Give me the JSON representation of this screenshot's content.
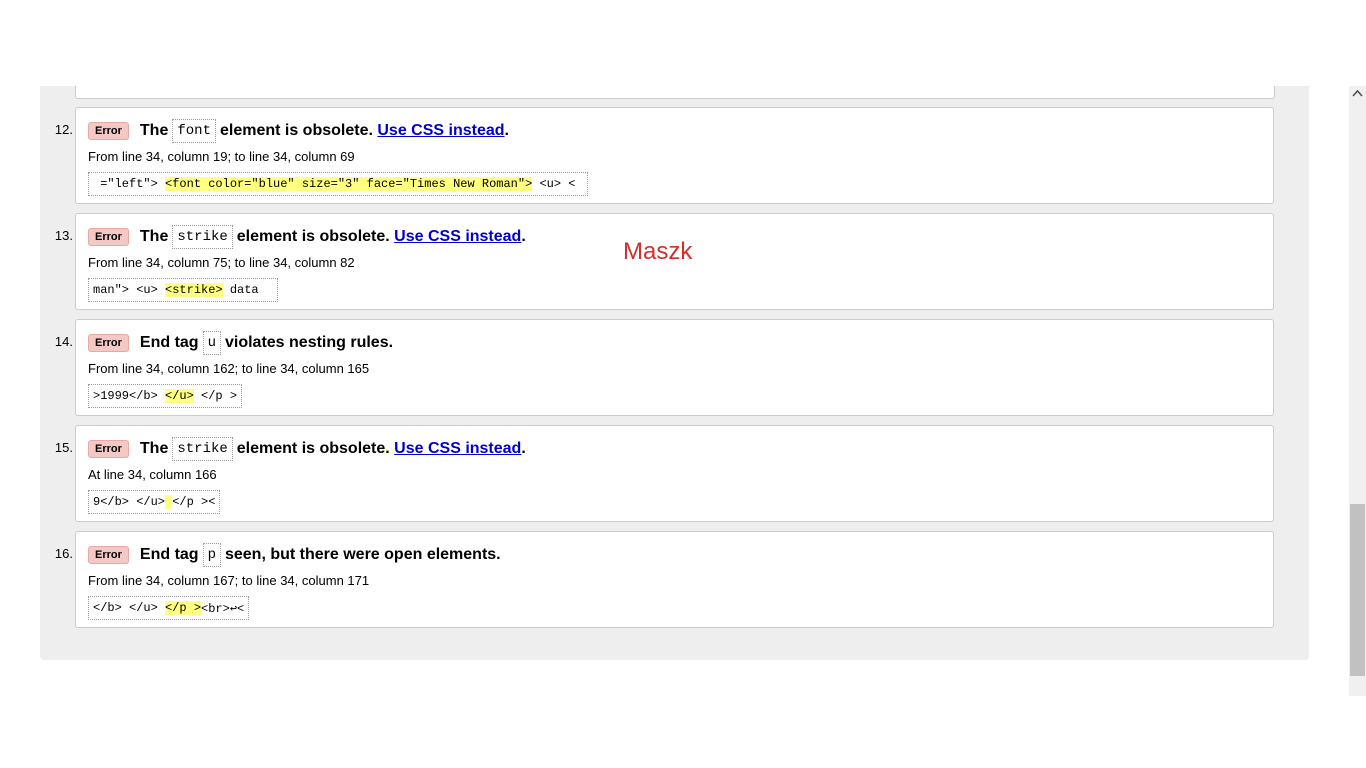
{
  "messages": [
    {
      "number": "12.",
      "type": "Error",
      "parts": [
        "The",
        "font",
        "element is obsolete.",
        "Use CSS instead",
        "."
      ],
      "location": "From line 34, column 19; to line 34, column 69",
      "extract": {
        "before": " =\"left\"> ",
        "highlight": "<font color=\"blue\" size=\"3\" face=\"Times New Roman\">",
        "after": " <u> < "
      }
    },
    {
      "number": "13.",
      "type": "Error",
      "parts": [
        "The",
        "strike",
        "element is obsolete.",
        "Use CSS instead",
        "."
      ],
      "location": "From line 34, column 75; to line 34, column 82",
      "extract": {
        "before": "man\"> <u> ",
        "highlight": "<strike>",
        "after": " data  "
      }
    },
    {
      "number": "14.",
      "type": "Error",
      "parts": [
        "End tag",
        "u",
        "violates nesting rules."
      ],
      "location": "From line 34, column 162; to line 34, column 165",
      "extract": {
        "before": ">1999</b> ",
        "highlight": "</u>",
        "after": " </p >"
      }
    },
    {
      "number": "15.",
      "type": "Error",
      "parts": [
        "The",
        "strike",
        "element is obsolete.",
        "Use CSS instead",
        "."
      ],
      "location": "At line 34, column 166",
      "extract": {
        "before": "9</b> </u>",
        "highlight": " ",
        "after": "</p ><"
      }
    },
    {
      "number": "16.",
      "type": "Error",
      "parts": [
        "End tag",
        "p",
        "seen, but there were open elements."
      ],
      "location": "From line 34, column 167; to line 34, column 171",
      "extract": {
        "before": "</b> </u> ",
        "highlight": "</p >",
        "after": "<br>↩<"
      }
    }
  ],
  "overlay": {
    "mask_text": "Maszk",
    "mask_color": "#d32f2f"
  },
  "colors": {
    "error_badge": "#f4c8c4",
    "highlight": "#ffff80",
    "link": "#0000cc"
  },
  "scrollbar": {
    "up_arrow_icon": "chevron-up-icon"
  }
}
